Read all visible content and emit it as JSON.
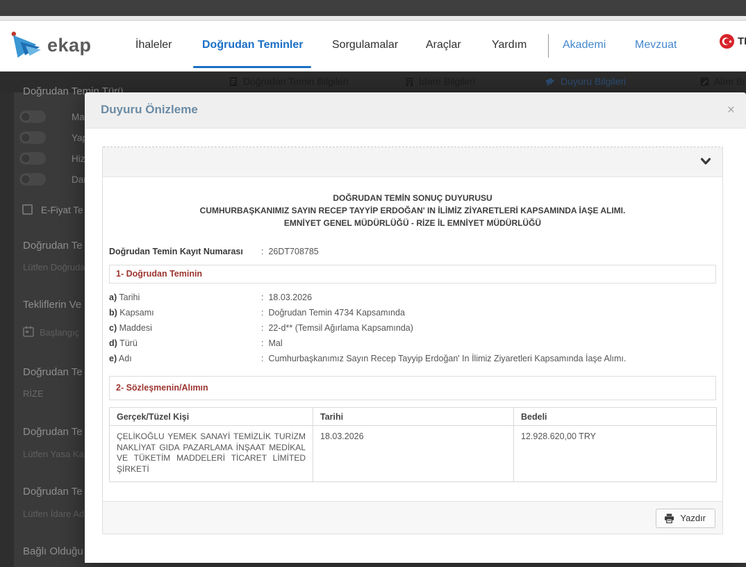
{
  "nav": {
    "brand": "ekap",
    "items": {
      "ihaleler": "İhaleler",
      "dogrudan": "Doğrudan Teminler",
      "sorgulamalar": "Sorgulamalar",
      "araclar": "Araçlar",
      "yardim": "Yardım",
      "akademi": "Akademi",
      "mevzuat": "Mevzuat"
    },
    "lang": "TR"
  },
  "tabs": {
    "t1": "Doğrudan Temin Bilgileri",
    "t2": "İdare Bilgileri",
    "t3": "Duyuru Bilgileri",
    "t4": "Alım Bi"
  },
  "sidebar": {
    "filter_title": "Doğrudan Temin Türü",
    "toggles": {
      "t1": "Ma",
      "t2": "Yap",
      "t3": "Hiz",
      "t4": "Dar"
    },
    "checkbox_label": "E-Fiyat Te",
    "g1_heading": "Doğrudan Te",
    "g1_value": "Lütfen Doğruda",
    "g2_heading": "Tekliflerin Ve",
    "g2_value": "Başlangıç",
    "g3_heading": "Doğrudan Te",
    "g3_value": "RİZE",
    "g4_heading": "Doğrudan Te",
    "g4_value": "Lütfen Yasa Ka",
    "g5_heading": "Doğrudan Te",
    "g5_value": "Lütfen İdare Ad",
    "g6_heading": "Bağlı Olduğu"
  },
  "modal": {
    "title": "Duyuru Önizleme",
    "close_glyph": "×",
    "print_label": "Yazdır",
    "doc": {
      "colon": ":",
      "heading_line1": "DOĞRUDAN TEMİN SONUÇ DUYURUSU",
      "heading_line2": "CUMHURBAŞKANIMIZ SAYIN RECEP TAYYİP ERDOĞAN' IN İLİMİZ ZİYARETLERİ KAPSAMINDA İAŞE ALIMI.",
      "heading_line3": "EMNİYET GENEL MÜDÜRLÜĞÜ - RİZE İL EMNİYET MÜDÜRLÜĞÜ",
      "record_label": "Doğrudan Temin Kayıt Numarası",
      "record_value": "26DT708785",
      "section1_title": "1- Doğrudan Teminin",
      "items": {
        "a": {
          "key": "a)",
          "label": "Tarihi",
          "value": "18.03.2026"
        },
        "b": {
          "key": "b)",
          "label": "Kapsamı",
          "value": "Doğrudan Temin 4734 Kapsamında"
        },
        "c": {
          "key": "c)",
          "label": "Maddesi",
          "value": "22-d** (Temsil Ağırlama Kapsamında)"
        },
        "d": {
          "key": "d)",
          "label": "Türü",
          "value": "Mal"
        },
        "e": {
          "key": "e)",
          "label": "Adı",
          "value": "Cumhurbaşkanımız Sayın Recep Tayyip Erdoğan' In İlimiz Ziyaretleri Kapsamında İaşe Alımı."
        }
      },
      "section2_title": "2- Sözleşmenin/Alımın",
      "table": {
        "headers": {
          "h1": "Gerçek/Tüzel Kişi",
          "h2": "Tarihi",
          "h3": "Bedeli"
        },
        "row": {
          "kisi": "ÇELİKOĞLU YEMEK SANAYİ TEMİZLİK TURİZM NAKLİYAT GIDA PAZARLAMA İNŞAAT MEDİKAL VE TÜKETİM MADDELERİ TİCARET LİMİTED ŞİRKETİ",
          "tarih": "18.03.2026",
          "bedel": "12.928.620,00 TRY"
        }
      }
    }
  },
  "colors": {
    "active_nav_blue": "#1b6fc4",
    "link_blue": "#4287cf",
    "modal_title_blue": "#6b8ba4",
    "section_red": "#9c3530",
    "flag_red": "#d8232a",
    "overlay_gray": "#3a3a3a"
  }
}
